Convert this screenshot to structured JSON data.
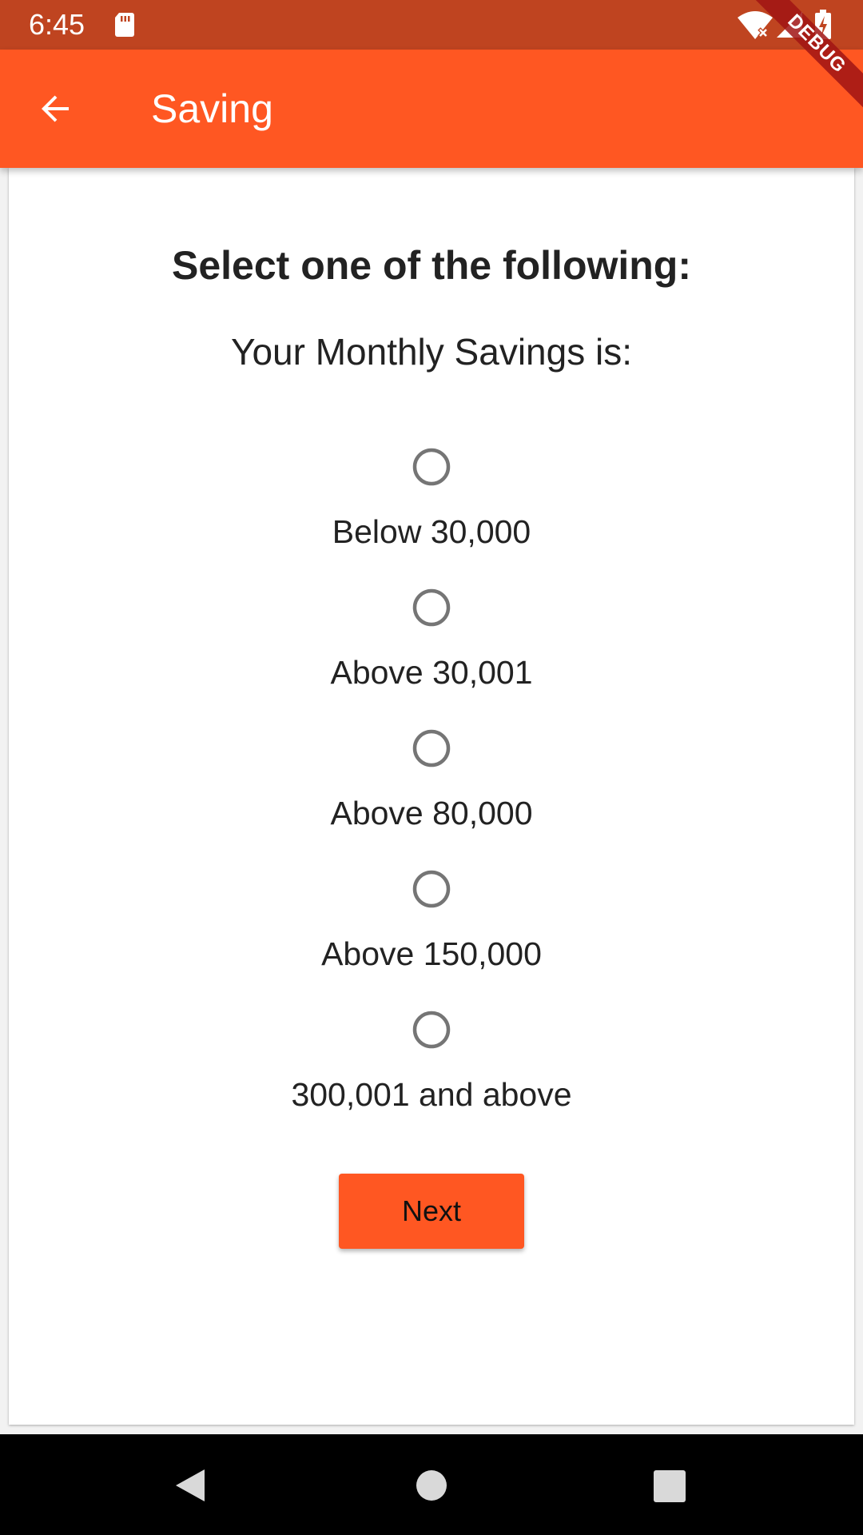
{
  "status_bar": {
    "time": "6:45",
    "icons": [
      "sd-card-icon",
      "wifi-off-icon",
      "signal-icon",
      "battery-charging-icon"
    ],
    "background_color": "#BF4420"
  },
  "debug_banner": {
    "label": "DEBUG"
  },
  "app_bar": {
    "title": "Saving",
    "back_icon": "arrow-back-icon",
    "background_color": "#FF5722"
  },
  "form": {
    "heading": "Select one of the following:",
    "question": "Your Monthly Savings is:",
    "options": [
      {
        "label": "Below 30,000",
        "selected": false
      },
      {
        "label": "Above 30,001",
        "selected": false
      },
      {
        "label": "Above 80,000",
        "selected": false
      },
      {
        "label": "Above 150,000",
        "selected": false
      },
      {
        "label": "300,001 and above",
        "selected": false
      }
    ],
    "next_label": "Next",
    "accent_color": "#FF5722"
  },
  "nav_bar": {
    "icons": [
      "nav-back-icon",
      "nav-home-icon",
      "nav-recents-icon"
    ]
  }
}
